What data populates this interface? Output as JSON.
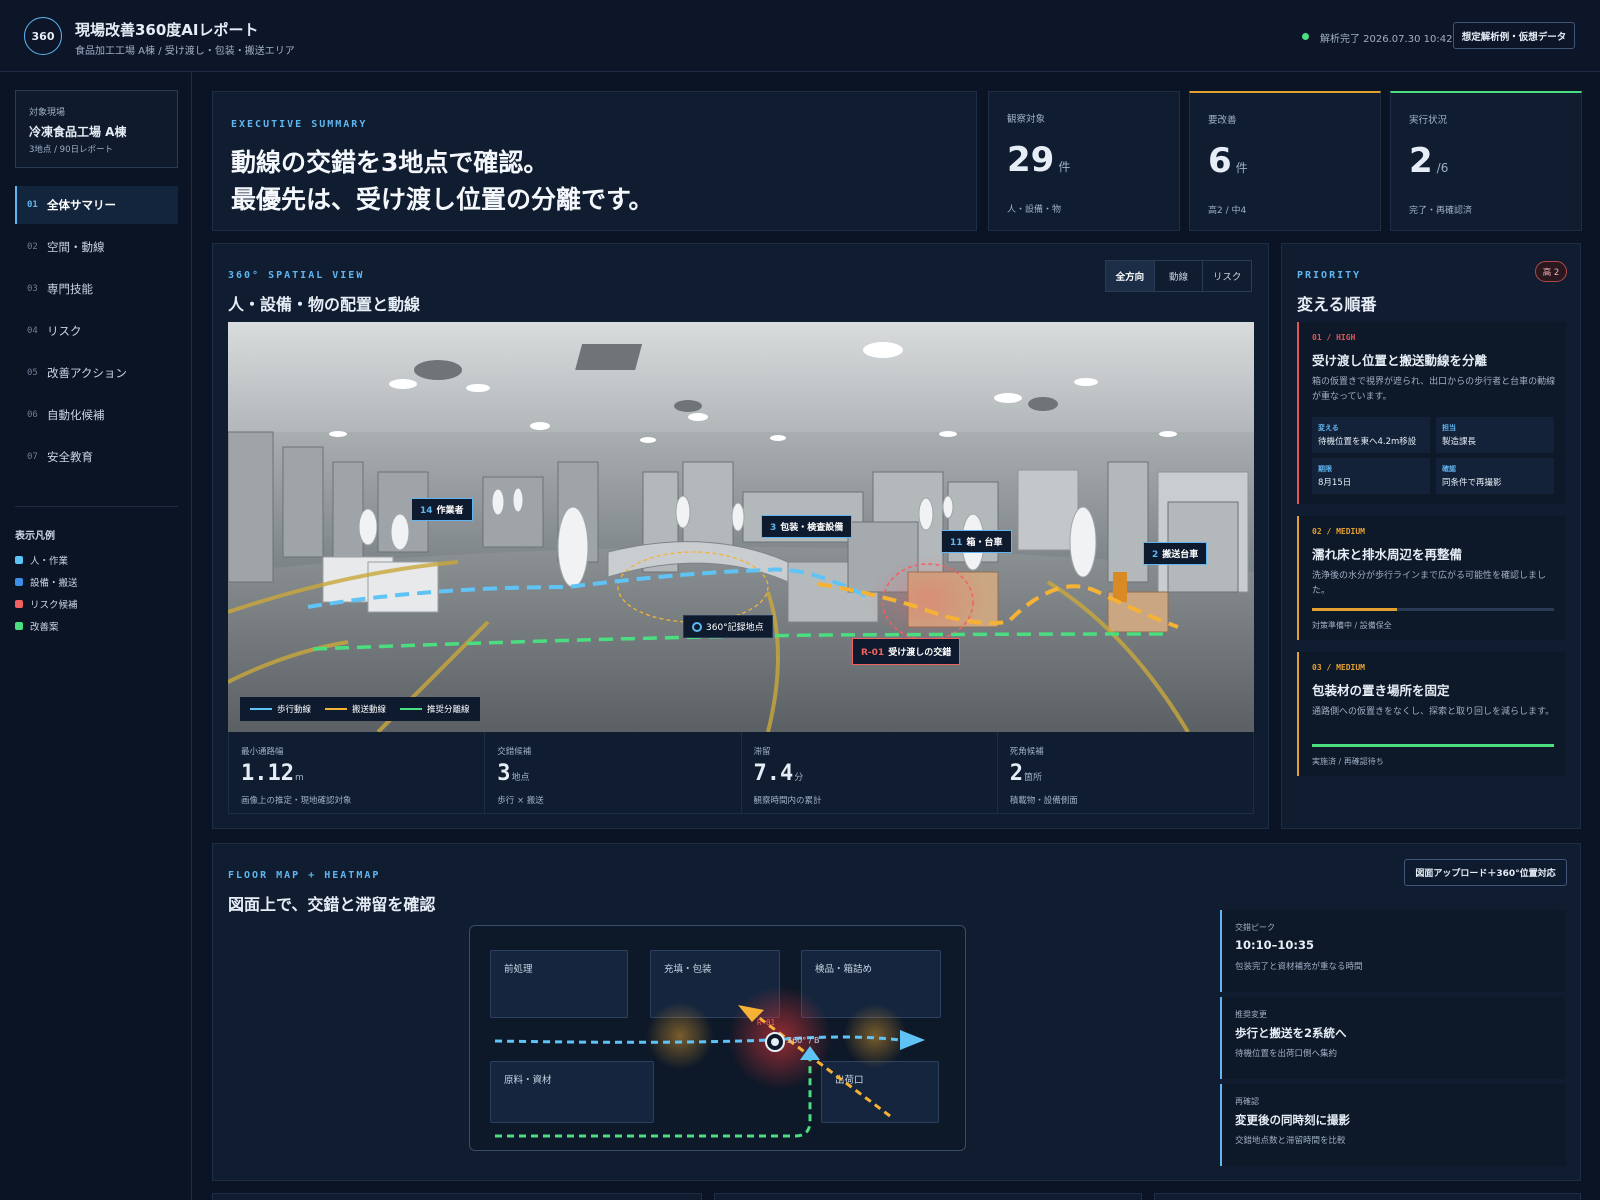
{
  "header": {
    "logo": "360",
    "title": "現場改善360度AIレポート",
    "subtitle": "食品加工工場 A棟 / 受け渡し・包装・搬送エリア",
    "status": "解析完了 2026.07.30 10:42",
    "demo_button": "想定解析例・仮想データ"
  },
  "sidebar": {
    "site_label": "対象現場",
    "site_name": "冷凍食品工場 A棟",
    "site_meta": "3地点 / 90日レポート",
    "nav": [
      {
        "num": "01",
        "label": "全体サマリー"
      },
      {
        "num": "02",
        "label": "空間・動線"
      },
      {
        "num": "03",
        "label": "専門技能"
      },
      {
        "num": "04",
        "label": "リスク"
      },
      {
        "num": "05",
        "label": "改善アクション"
      },
      {
        "num": "06",
        "label": "自動化候補"
      },
      {
        "num": "07",
        "label": "安全教育"
      }
    ],
    "legend_title": "表示凡例",
    "legend": [
      {
        "label": "人・作業",
        "color": "#5fc4f5"
      },
      {
        "label": "設備・搬送",
        "color": "#3f8ee8"
      },
      {
        "label": "リスク候補",
        "color": "#f26060"
      },
      {
        "label": "改善案",
        "color": "#4ade80"
      }
    ]
  },
  "summary": {
    "kicker": "EXECUTIVE SUMMARY",
    "line1": "動線の交錯を3地点で確認。",
    "line2": "最優先は、受け渡し位置の分離です。"
  },
  "stats": [
    {
      "label": "観察対象",
      "value": "29",
      "unit": "件",
      "sub": "人・設備・物"
    },
    {
      "label": "要改善",
      "value": "6",
      "unit": "件",
      "sub": "高2 / 中4",
      "accent": "#e3a030"
    },
    {
      "label": "実行状況",
      "value": "2",
      "unit": "/6",
      "sub": "完了・再確認済",
      "accent": "#4ade80"
    }
  ],
  "spatial": {
    "kicker": "360° SPATIAL VIEW",
    "title": "人・設備・物の配置と動線",
    "tabs": [
      "全方向",
      "動線",
      "リスク"
    ],
    "tags": {
      "worker_num": "14",
      "worker": "作業者",
      "pack_num": "3",
      "pack": "包装・検査設備",
      "box_num": "11",
      "box": "箱・台車",
      "cart_num": "2",
      "cart": "搬送台車",
      "point": "360°記録地点",
      "risk_num": "R-01",
      "risk": "受け渡しの交錯"
    },
    "legend": [
      {
        "label": "歩行動線",
        "color": "#5fc4f5"
      },
      {
        "label": "搬送動線",
        "color": "#f5b234"
      },
      {
        "label": "推奨分離線",
        "color": "#4ade80"
      }
    ],
    "metrics": [
      {
        "label": "最小通路幅",
        "value": "1.12",
        "unit": "m",
        "sub": "画像上の推定・現地確認対象"
      },
      {
        "label": "交錯候補",
        "value": "3",
        "unit": "地点",
        "sub": "歩行 × 搬送"
      },
      {
        "label": "滞留",
        "value": "7.4",
        "unit": "分",
        "sub": "観察時間内の累計"
      },
      {
        "label": "死角候補",
        "value": "2",
        "unit": "箇所",
        "sub": "積載物・設備側面"
      }
    ]
  },
  "priority": {
    "kicker": "PRIORITY",
    "title": "変える順番",
    "badge": "高 2",
    "items": [
      {
        "key": "01 / HIGH",
        "title": "受け渡し位置と搬送動線を分離",
        "desc": "箱の仮置きで視界が遮られ、出口からの歩行者と台車の動線が重なっています。",
        "cells": [
          {
            "k": "変える",
            "v": "待機位置を東へ4.2m移設"
          },
          {
            "k": "担当",
            "v": "製造課長"
          },
          {
            "k": "期限",
            "v": "8月15日"
          },
          {
            "k": "確認",
            "v": "同条件で再撮影"
          }
        ]
      },
      {
        "key": "02 / MEDIUM",
        "title": "濡れ床と排水周辺を再整備",
        "desc": "洗浄後の水分が歩行ラインまで広がる可能性を確認しました。",
        "progress": 0.35,
        "progress_color": "#e3a030",
        "foot": "対策準備中 / 設備保全"
      },
      {
        "key": "03 / MEDIUM",
        "title": "包装材の置き場所を固定",
        "desc": "通路側への仮置きをなくし、探索と取り回しを減らします。",
        "progress": 1.0,
        "progress_color": "#4ade80",
        "foot": "実施済 / 再確認待ち"
      }
    ]
  },
  "floor": {
    "kicker": "FLOOR MAP + HEATMAP",
    "title": "図面上で、交錯と滞留を確認",
    "upload_button": "図面アップロード＋360°位置対応",
    "zones": [
      "前処理",
      "充填・包装",
      "検品・箱詰め",
      "原料・資材",
      "出荷口"
    ],
    "marker_label": "360° / B",
    "risk_label": "R-01",
    "insights": [
      {
        "k": "交錯ピーク",
        "v": "10:10–10:35",
        "s": "包装完了と資材補充が重なる時間"
      },
      {
        "k": "推奨変更",
        "v": "歩行と搬送を2系統へ",
        "s": "待機位置を出荷口側へ集約"
      },
      {
        "k": "再確認",
        "v": "変更後の同時刻に撮影",
        "s": "交錯地点数と滞留時間を比較"
      }
    ]
  }
}
